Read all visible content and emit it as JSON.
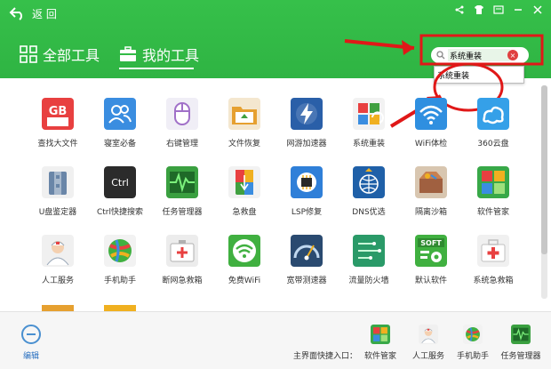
{
  "header": {
    "back_label": "返 回",
    "tabs": [
      {
        "label": "全部工具",
        "active": false
      },
      {
        "label": "我的工具",
        "active": true
      }
    ],
    "search": {
      "value": "系统重装",
      "suggestion": "系统重装"
    }
  },
  "tools": [
    {
      "label": "查找大文件",
      "icon": "gb-file-icon",
      "color": "#e84040"
    },
    {
      "label": "寝室必备",
      "icon": "users-icon",
      "color": "#3a8de0"
    },
    {
      "label": "右键管理",
      "icon": "mouse-icon",
      "color": "#b070d0"
    },
    {
      "label": "文件恢复",
      "icon": "folder-icon",
      "color": "#e6a030"
    },
    {
      "label": "网游加速器",
      "icon": "lightning-icon",
      "color": "#2a5fa8"
    },
    {
      "label": "系统重装",
      "icon": "windows-icon",
      "color": "#e8e8e8"
    },
    {
      "label": "WiFi体检",
      "icon": "wifi-icon",
      "color": "#2f8fe0"
    },
    {
      "label": "360云盘",
      "icon": "cloud-icon",
      "color": "#35a0e8"
    },
    {
      "label": "U盘鉴定器",
      "icon": "usb-check-icon",
      "color": "#f0f0f0"
    },
    {
      "label": "Ctrl快捷搜索",
      "icon": "ctrl-key-icon",
      "color": "#2b2b2b"
    },
    {
      "label": "任务管理器",
      "icon": "pulse-icon",
      "color": "#3aa040"
    },
    {
      "label": "急救盘",
      "icon": "usb-drive-icon",
      "color": "#f0f0f0"
    },
    {
      "label": "LSP修复",
      "icon": "chip-icon",
      "color": "#2f7fd8"
    },
    {
      "label": "DNS优选",
      "icon": "globe-icon",
      "color": "#1f60a8"
    },
    {
      "label": "隔离沙箱",
      "icon": "sandbox-icon",
      "color": "#a06040"
    },
    {
      "label": "软件管家",
      "icon": "apps-icon",
      "color": "#38a848"
    },
    {
      "label": "人工服务",
      "icon": "doctor-icon",
      "color": "#f0f0f0"
    },
    {
      "label": "手机助手",
      "icon": "ball-icon",
      "color": "#40b040"
    },
    {
      "label": "断网急救箱",
      "icon": "first-aid-icon",
      "color": "#e8e8e8"
    },
    {
      "label": "免费WiFi",
      "icon": "wifi-green-icon",
      "color": "#40b040"
    },
    {
      "label": "宽带测速器",
      "icon": "speed-icon",
      "color": "#2a4a70"
    },
    {
      "label": "流量防火墙",
      "icon": "flow-icon",
      "color": "#2a9a68"
    },
    {
      "label": "默认软件",
      "icon": "soft-icon",
      "color": "#40b040"
    },
    {
      "label": "系统急救箱",
      "icon": "medkit-icon",
      "color": "#e8e8e8"
    }
  ],
  "bottom": {
    "edit_label": "编辑",
    "quick_label": "主界面快捷入口：",
    "items": [
      {
        "label": "软件管家",
        "icon": "apps-icon",
        "color": "#38a848"
      },
      {
        "label": "人工服务",
        "icon": "doctor-icon",
        "color": "#f0f0f0"
      },
      {
        "label": "手机助手",
        "icon": "ball-icon",
        "color": "#40b040"
      },
      {
        "label": "任务管理器",
        "icon": "pulse-icon",
        "color": "#3aa040"
      }
    ]
  },
  "colors": {
    "header_green": "#33bb47",
    "annotation_red": "#e01818"
  }
}
